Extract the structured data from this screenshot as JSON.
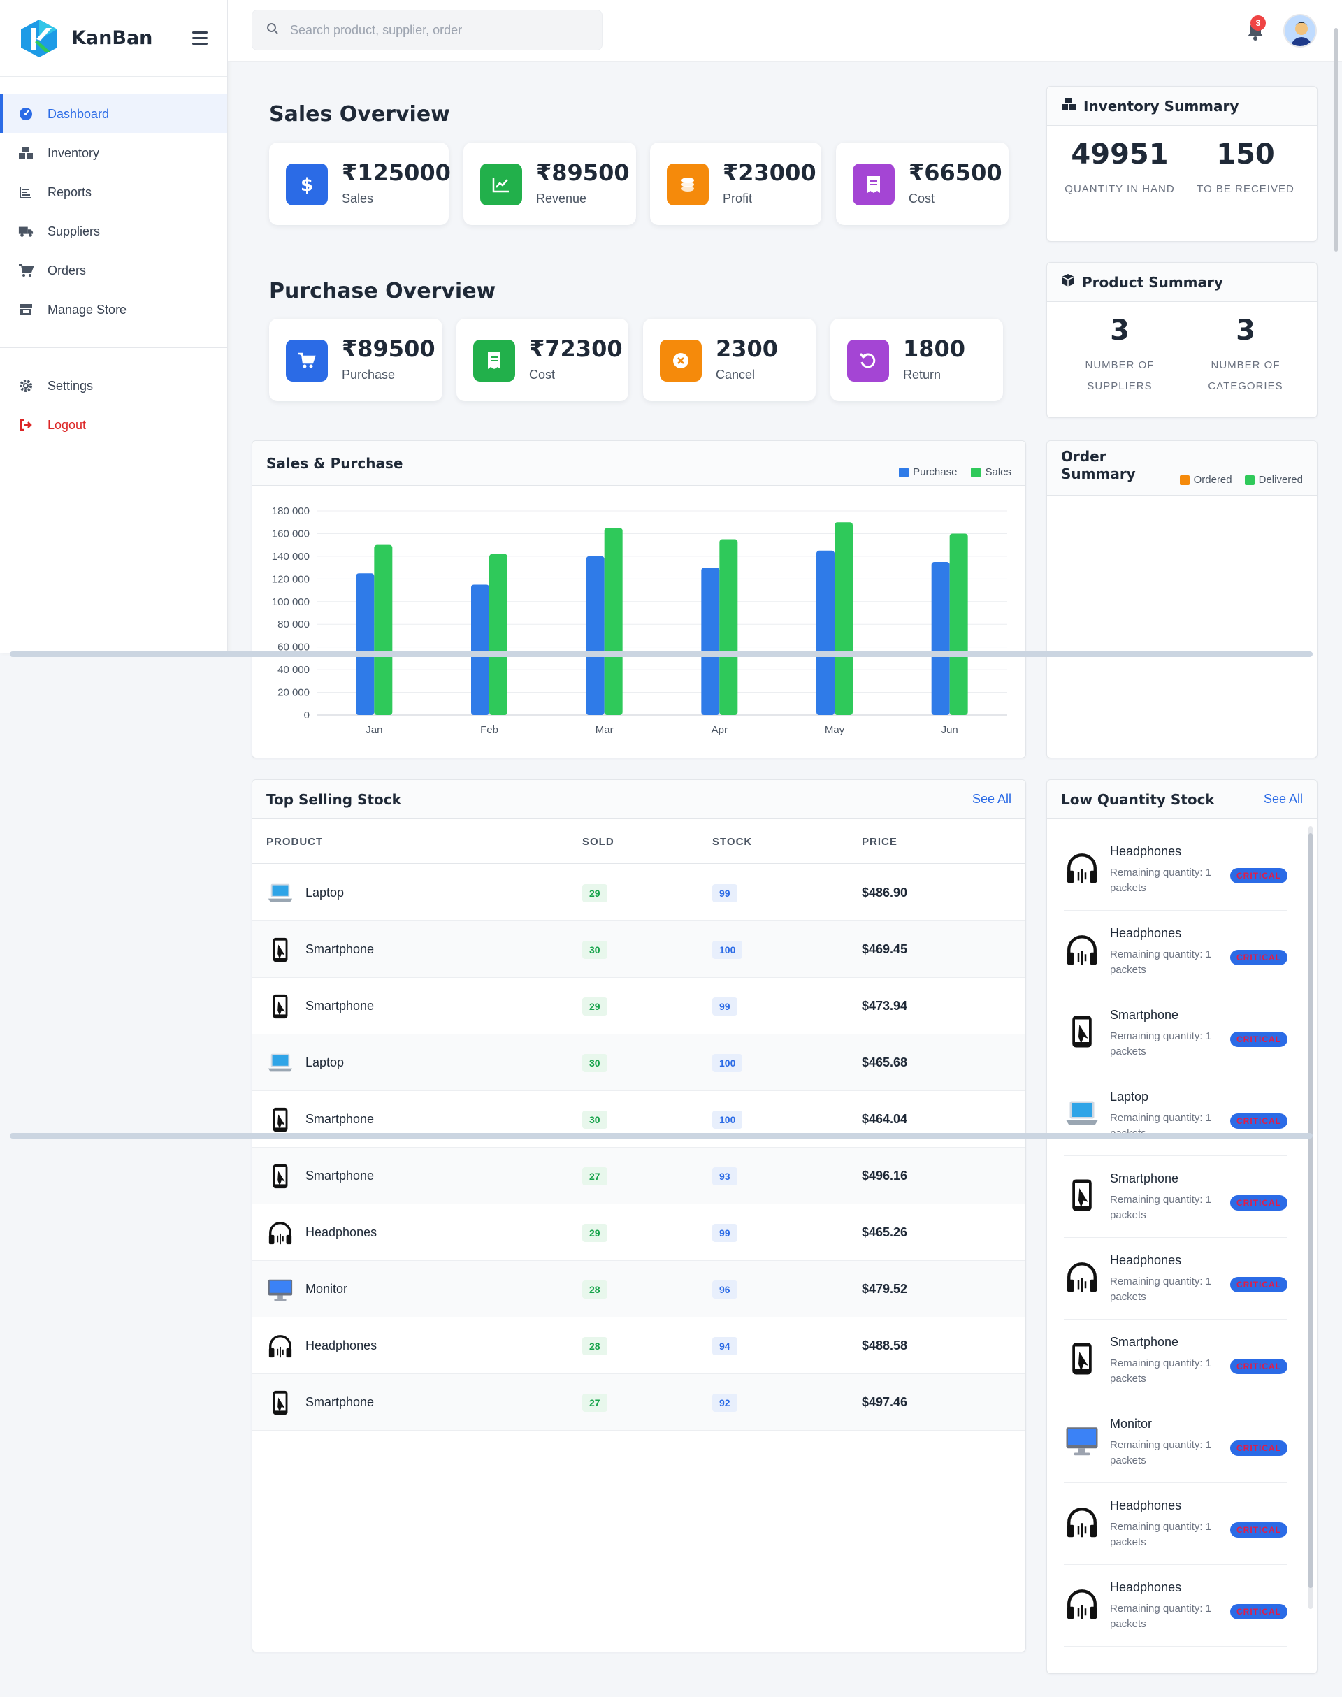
{
  "app": {
    "name": "KanBan"
  },
  "sidebar": {
    "items": [
      {
        "label": "Dashboard",
        "icon": "dashboard-icon",
        "active": true
      },
      {
        "label": "Inventory",
        "icon": "inventory-icon"
      },
      {
        "label": "Reports",
        "icon": "reports-icon"
      },
      {
        "label": "Suppliers",
        "icon": "truck-icon"
      },
      {
        "label": "Orders",
        "icon": "cart-icon"
      },
      {
        "label": "Manage Store",
        "icon": "store-icon"
      }
    ],
    "bottom": [
      {
        "label": "Settings",
        "icon": "gear-icon"
      },
      {
        "label": "Logout",
        "icon": "logout-icon"
      }
    ]
  },
  "topbar": {
    "search_placeholder": "Search product, supplier, order",
    "notification_count": "3"
  },
  "sales_overview": {
    "title": "Sales Overview",
    "cards": [
      {
        "value": "₹125000",
        "label": "Sales",
        "color": "#2b6be6",
        "icon": "dollar-icon"
      },
      {
        "value": "₹89500",
        "label": "Revenue",
        "color": "#22b04b",
        "icon": "chart-line-icon"
      },
      {
        "value": "₹23000",
        "label": "Profit",
        "color": "#f58a0b",
        "icon": "coins-icon"
      },
      {
        "value": "₹66500",
        "label": "Cost",
        "color": "#a445d4",
        "icon": "receipt-icon"
      }
    ]
  },
  "purchase_overview": {
    "title": "Purchase Overview",
    "cards": [
      {
        "value": "₹89500",
        "label": "Purchase",
        "color": "#2b6be6",
        "icon": "cart-icon"
      },
      {
        "value": "₹72300",
        "label": "Cost",
        "color": "#22b04b",
        "icon": "receipt-icon"
      },
      {
        "value": "2300",
        "label": "Cancel",
        "color": "#f58a0b",
        "icon": "cancel-icon"
      },
      {
        "value": "1800",
        "label": "Return",
        "color": "#a445d4",
        "icon": "return-icon"
      }
    ]
  },
  "inventory_summary": {
    "title": "Inventory Summary",
    "items": [
      {
        "value": "49951",
        "label": "QUANTITY IN HAND"
      },
      {
        "value": "150",
        "label": "TO BE RECEIVED"
      }
    ]
  },
  "product_summary": {
    "title": "Product Summary",
    "items": [
      {
        "value": "3",
        "label": "NUMBER OF SUPPLIERS"
      },
      {
        "value": "3",
        "label": "NUMBER OF CATEGORIES"
      }
    ]
  },
  "sales_purchase": {
    "title": "Sales & Purchase",
    "legend": [
      "Purchase",
      "Sales"
    ]
  },
  "order_summary": {
    "title": "Order Summary",
    "legend": [
      "Ordered",
      "Delivered"
    ]
  },
  "chart_data": {
    "type": "bar",
    "categories": [
      "Jan",
      "Feb",
      "Mar",
      "Apr",
      "May",
      "Jun"
    ],
    "series": [
      {
        "name": "Purchase",
        "values": [
          125000,
          115000,
          140000,
          130000,
          145000,
          135000
        ],
        "color": "#2f7be8"
      },
      {
        "name": "Sales",
        "values": [
          150000,
          142000,
          165000,
          155000,
          170000,
          160000
        ],
        "color": "#2fc95a"
      }
    ],
    "yticks": [
      "0",
      "20 000",
      "40 000",
      "60 000",
      "80 000",
      "100 000",
      "120 000",
      "140 000",
      "160 000",
      "180 000"
    ],
    "ylim": [
      0,
      180000
    ],
    "grid": true,
    "legend_position": "top-right"
  },
  "top_selling": {
    "title": "Top Selling Stock",
    "see_all": "See All",
    "columns": [
      "PRODUCT",
      "SOLD",
      "STOCK",
      "PRICE"
    ],
    "rows": [
      {
        "product": "Laptop",
        "icon": "laptop-icon",
        "sold": "29",
        "stock": "99",
        "price": "$486.90"
      },
      {
        "product": "Smartphone",
        "icon": "smartphone-icon",
        "sold": "30",
        "stock": "100",
        "price": "$469.45"
      },
      {
        "product": "Smartphone",
        "icon": "smartphone-icon",
        "sold": "29",
        "stock": "99",
        "price": "$473.94"
      },
      {
        "product": "Laptop",
        "icon": "laptop-icon",
        "sold": "30",
        "stock": "100",
        "price": "$465.68"
      },
      {
        "product": "Smartphone",
        "icon": "smartphone-icon",
        "sold": "30",
        "stock": "100",
        "price": "$464.04"
      },
      {
        "product": "Smartphone",
        "icon": "smartphone-icon",
        "sold": "27",
        "stock": "93",
        "price": "$496.16"
      },
      {
        "product": "Headphones",
        "icon": "headphones-icon",
        "sold": "29",
        "stock": "99",
        "price": "$465.26"
      },
      {
        "product": "Monitor",
        "icon": "monitor-icon",
        "sold": "28",
        "stock": "96",
        "price": "$479.52"
      },
      {
        "product": "Headphones",
        "icon": "headphones-icon",
        "sold": "28",
        "stock": "94",
        "price": "$488.58"
      },
      {
        "product": "Smartphone",
        "icon": "smartphone-icon",
        "sold": "27",
        "stock": "92",
        "price": "$497.46"
      }
    ]
  },
  "low_stock": {
    "title": "Low Quantity Stock",
    "see_all": "See All",
    "items": [
      {
        "name": "Headphones",
        "icon": "headphones-icon",
        "remaining": "Remaining quantity: 1 packets",
        "badge": "CRITICAL"
      },
      {
        "name": "Headphones",
        "icon": "headphones-icon",
        "remaining": "Remaining quantity: 1 packets",
        "badge": "CRITICAL"
      },
      {
        "name": "Smartphone",
        "icon": "smartphone-icon",
        "remaining": "Remaining quantity: 1 packets",
        "badge": "CRITICAL"
      },
      {
        "name": "Laptop",
        "icon": "laptop-icon",
        "remaining": "Remaining quantity: 1 packets",
        "badge": "CRITICAL"
      },
      {
        "name": "Smartphone",
        "icon": "smartphone-icon",
        "remaining": "Remaining quantity: 1 packets",
        "badge": "CRITICAL"
      },
      {
        "name": "Headphones",
        "icon": "headphones-icon",
        "remaining": "Remaining quantity: 1 packets",
        "badge": "CRITICAL"
      },
      {
        "name": "Smartphone",
        "icon": "smartphone-icon",
        "remaining": "Remaining quantity: 1 packets",
        "badge": "CRITICAL"
      },
      {
        "name": "Monitor",
        "icon": "monitor-icon",
        "remaining": "Remaining quantity: 1 packets",
        "badge": "CRITICAL"
      },
      {
        "name": "Headphones",
        "icon": "headphones-icon",
        "remaining": "Remaining quantity: 1 packets",
        "badge": "CRITICAL"
      },
      {
        "name": "Headphones",
        "icon": "headphones-icon",
        "remaining": "Remaining quantity: 1 packets",
        "badge": "CRITICAL"
      }
    ]
  }
}
